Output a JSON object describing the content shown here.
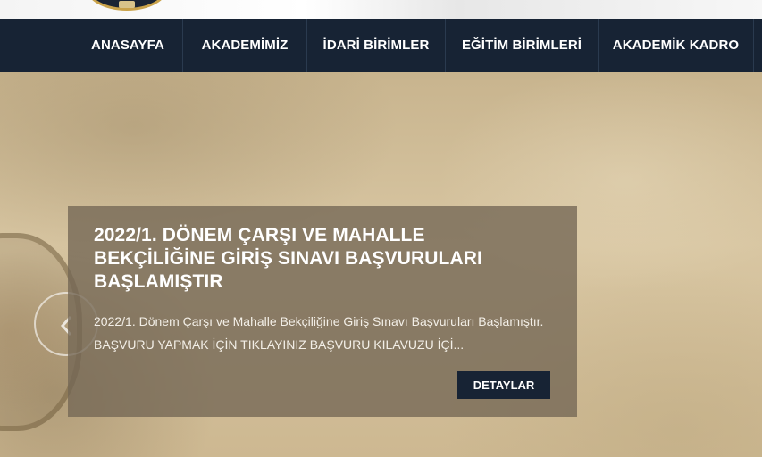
{
  "nav": {
    "items": [
      {
        "label": "ANASAYFA"
      },
      {
        "label": "AKADEMİMİZ"
      },
      {
        "label": "İDARİ BİRİMLER"
      },
      {
        "label": "EĞİTİM BİRİMLERİ"
      },
      {
        "label": "AKADEMİK KADRO"
      }
    ]
  },
  "slider": {
    "title": "2022/1. DÖNEM ÇARŞI VE MAHALLE BEKÇİLİĞİNE GİRİŞ SINAVI BAŞVURULARI BAŞLAMIŞTIR",
    "text": "2022/1. Dönem Çarşı ve Mahalle Bekçiliğine Giriş Sınavı Başvuruları Başlamıştır. BAŞVURU YAPMAK İÇİN TIKLAYINIZ BAŞVURU KILAVUZU İÇİ...",
    "button_label": "DETAYLAR",
    "prev_icon": "chevron-left-icon"
  },
  "colors": {
    "nav_bg": "#172334",
    "button_bg": "#172334",
    "caption_bg": "#736755"
  }
}
